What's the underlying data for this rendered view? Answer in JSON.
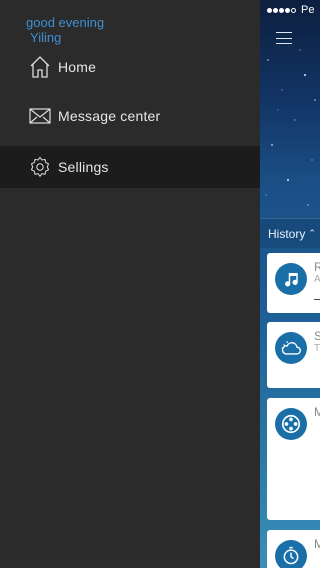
{
  "drawer": {
    "greeting": "good evening",
    "username": "Yiling",
    "items": [
      {
        "label": "Home",
        "icon": "home-icon"
      },
      {
        "label": "Message  center",
        "icon": "envelope-icon"
      },
      {
        "label": "Sellings",
        "icon": "gear-icon",
        "active": true
      }
    ]
  },
  "main": {
    "status": {
      "carrier": "Pe"
    },
    "history_label": "History",
    "cards": [
      {
        "icon": "music-icon",
        "letter": "R",
        "sub": "A"
      },
      {
        "icon": "cloud-icon",
        "letter": "S",
        "sub": "T"
      },
      {
        "icon": "film-reel-icon",
        "letter": "M",
        "sub": ""
      },
      {
        "icon": "stopwatch-icon",
        "letter": "M",
        "sub": ""
      }
    ]
  },
  "colors": {
    "accent": "#3f8fd0",
    "drawer_bg": "#2b2b2b",
    "active_item_bg": "#1c1c1c",
    "icon_circle": "#1a6fa8"
  }
}
